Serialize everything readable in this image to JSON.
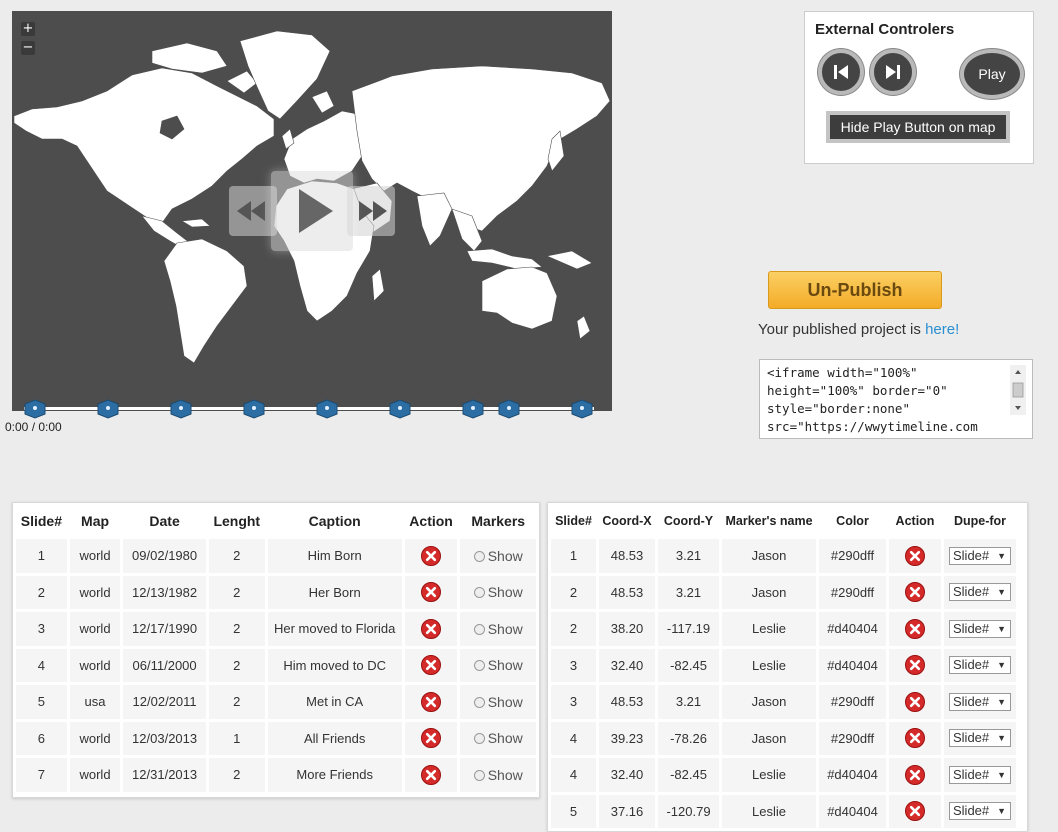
{
  "map": {
    "zoom_in": "+",
    "zoom_out": "−",
    "background": "#4d4d4d",
    "land": "#ffffff",
    "time": "0:00 / 0:00",
    "timeline_markers": 9
  },
  "external": {
    "title": "External Controlers",
    "play_label": "Play",
    "hide_button_label": "Hide Play Button on map"
  },
  "publish": {
    "button_label": "Un-Publish",
    "text": "Your published project is ",
    "link_text": "here!",
    "embed_code": "<iframe width=\"100%\"\nheight=\"100%\" border=\"0\"\nstyle=\"border:none\"\nsrc=\"https://wwytimeline.com"
  },
  "slides_table": {
    "headers": [
      "Slide#",
      "Map",
      "Date",
      "Lenght",
      "Caption",
      "Action",
      "Markers"
    ],
    "rows": [
      {
        "slide": "1",
        "map": "world",
        "date": "09/02/1980",
        "length": "2",
        "caption": "Him Born",
        "markers": "Show"
      },
      {
        "slide": "2",
        "map": "world",
        "date": "12/13/1982",
        "length": "2",
        "caption": "Her Born",
        "markers": "Show"
      },
      {
        "slide": "3",
        "map": "world",
        "date": "12/17/1990",
        "length": "2",
        "caption": "Her moved to Florida",
        "markers": "Show"
      },
      {
        "slide": "4",
        "map": "world",
        "date": "06/11/2000",
        "length": "2",
        "caption": "Him moved to DC",
        "markers": "Show"
      },
      {
        "slide": "5",
        "map": "usa",
        "date": "12/02/2011",
        "length": "2",
        "caption": "Met in CA",
        "markers": "Show"
      },
      {
        "slide": "6",
        "map": "world",
        "date": "12/03/2013",
        "length": "1",
        "caption": "All Friends",
        "markers": "Show"
      },
      {
        "slide": "7",
        "map": "world",
        "date": "12/31/2013",
        "length": "2",
        "caption": "More Friends",
        "markers": "Show"
      }
    ]
  },
  "markers_table": {
    "headers": [
      "Slide#",
      "Coord-X",
      "Coord-Y",
      "Marker's name",
      "Color",
      "Action",
      "Dupe-for"
    ],
    "rows": [
      {
        "slide": "1",
        "x": "48.53",
        "y": "3.21",
        "name": "Jason",
        "color": "#290dff",
        "dupe": "Slide#"
      },
      {
        "slide": "2",
        "x": "48.53",
        "y": "3.21",
        "name": "Jason",
        "color": "#290dff",
        "dupe": "Slide#"
      },
      {
        "slide": "2",
        "x": "38.20",
        "y": "-117.19",
        "name": "Leslie",
        "color": "#d40404",
        "dupe": "Slide#"
      },
      {
        "slide": "3",
        "x": "32.40",
        "y": "-82.45",
        "name": "Leslie",
        "color": "#d40404",
        "dupe": "Slide#"
      },
      {
        "slide": "3",
        "x": "48.53",
        "y": "3.21",
        "name": "Jason",
        "color": "#290dff",
        "dupe": "Slide#"
      },
      {
        "slide": "4",
        "x": "39.23",
        "y": "-78.26",
        "name": "Jason",
        "color": "#290dff",
        "dupe": "Slide#"
      },
      {
        "slide": "4",
        "x": "32.40",
        "y": "-82.45",
        "name": "Leslie",
        "color": "#d40404",
        "dupe": "Slide#"
      },
      {
        "slide": "5",
        "x": "37.16",
        "y": "-120.79",
        "name": "Leslie",
        "color": "#d40404",
        "dupe": "Slide#"
      }
    ]
  }
}
